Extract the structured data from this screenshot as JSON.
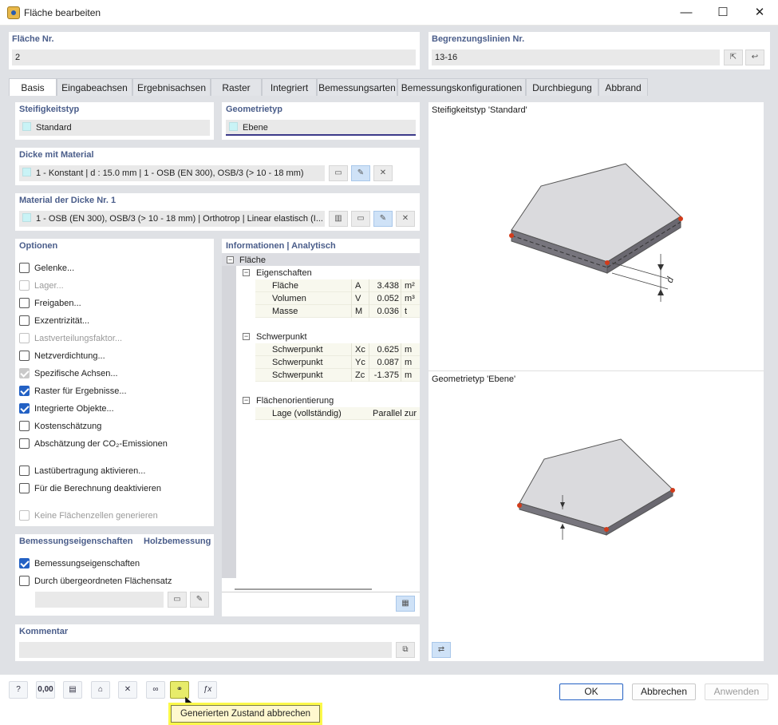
{
  "window": {
    "title": "Fläche bearbeiten",
    "min_glyph": "—",
    "max_glyph": "☐",
    "close_glyph": "✕"
  },
  "surface_no": {
    "label": "Fläche Nr.",
    "value": "2"
  },
  "boundary": {
    "label": "Begrenzungslinien Nr.",
    "value": "13-16"
  },
  "tabs": [
    "Basis",
    "Eingabeachsen",
    "Ergebnisachsen",
    "Raster",
    "Integriert",
    "Bemessungsarten",
    "Bemessungskonfigurationen",
    "Durchbiegung",
    "Abbrand"
  ],
  "stiffness": {
    "label": "Steifigkeitstyp",
    "value": "Standard"
  },
  "geometry": {
    "label": "Geometrietyp",
    "value": "Ebene"
  },
  "thickness": {
    "label": "Dicke mit Material",
    "value": "1 - Konstant | d : 15.0 mm | 1 - OSB (EN 300), OSB/3 (> 10 - 18 mm)"
  },
  "material": {
    "label": "Material der Dicke Nr. 1",
    "value": "1 - OSB (EN 300), OSB/3 (> 10 - 18 mm) | Orthotrop | Linear elastisch (I..."
  },
  "options": {
    "label": "Optionen",
    "items": [
      {
        "label": "Gelenke...",
        "state": "off"
      },
      {
        "label": "Lager...",
        "state": "dim"
      },
      {
        "label": "Freigaben...",
        "state": "off"
      },
      {
        "label": "Exzentrizität...",
        "state": "off"
      },
      {
        "label": "Lastverteilungsfaktor...",
        "state": "dim"
      },
      {
        "label": "Netzverdichtung...",
        "state": "off"
      },
      {
        "label": "Spezifische Achsen...",
        "state": "dimon"
      },
      {
        "label": "Raster für Ergebnisse...",
        "state": "on"
      },
      {
        "label": "Integrierte Objekte...",
        "state": "on"
      },
      {
        "label": "Kostenschätzung",
        "state": "off"
      },
      {
        "label": "Abschätzung der CO₂-Emissionen",
        "state": "off"
      },
      {
        "label": "Lastübertragung aktivieren...",
        "state": "off"
      },
      {
        "label": "Für die Berechnung deaktivieren",
        "state": "off"
      },
      {
        "label": "Keine Flächenzellen generieren",
        "state": "dim"
      }
    ]
  },
  "design": {
    "label": "Bemessungseigenschaften",
    "label2": "Holzbemessung",
    "items": [
      {
        "label": "Bemessungseigenschaften",
        "state": "on"
      },
      {
        "label": "Durch übergeordneten Flächensatz",
        "state": "off"
      }
    ]
  },
  "info": {
    "label": "Informationen | Analytisch",
    "root": "Fläche",
    "props_label": "Eigenschaften",
    "props": [
      {
        "name": "Fläche",
        "sym": "A",
        "val": "3.438",
        "unit": "m²"
      },
      {
        "name": "Volumen",
        "sym": "V",
        "val": "0.052",
        "unit": "m³"
      },
      {
        "name": "Masse",
        "sym": "M",
        "val": "0.036",
        "unit": "t"
      }
    ],
    "cog_label": "Schwerpunkt",
    "cog": [
      {
        "name": "Schwerpunkt",
        "sym": "Xc",
        "val": "0.625",
        "unit": "m"
      },
      {
        "name": "Schwerpunkt",
        "sym": "Yc",
        "val": "0.087",
        "unit": "m"
      },
      {
        "name": "Schwerpunkt",
        "sym": "Zc",
        "val": "-1.375",
        "unit": "m"
      }
    ],
    "orient_label": "Flächenorientierung",
    "orient_name": "Lage (vollständig)",
    "orient_val": "Parallel zur"
  },
  "preview": {
    "top_label": "Steifigkeitstyp 'Standard'",
    "bottom_label": "Geometrietyp 'Ebene'",
    "dim_label": "d"
  },
  "comment": {
    "label": "Kommentar",
    "value": ""
  },
  "buttons": {
    "ok": "OK",
    "cancel": "Abbrechen",
    "apply": "Anwenden"
  },
  "tooltip": "Generierten Zustand abbrechen",
  "colors": {
    "accent": "#2361c4",
    "group_title": "#4a5d8a",
    "tooltip_highlight": "#fcf94a"
  }
}
